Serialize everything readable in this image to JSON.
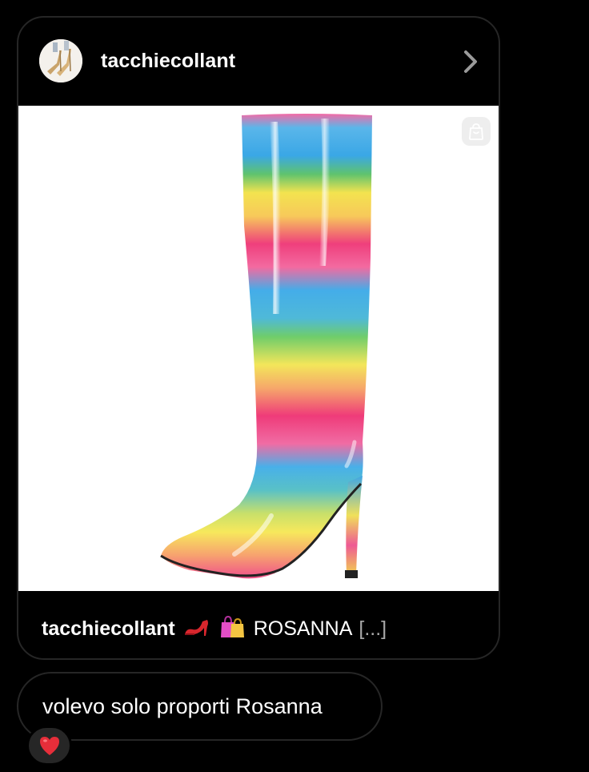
{
  "post": {
    "username": "tacchiecollant",
    "avatar_icon": "gold-heels-avatar",
    "image_icon": "rainbow-stiletto-boot",
    "shopping_icon": "shopping-bag-icon",
    "caption": {
      "username": "tacchiecollant",
      "emojis": [
        "high-heel-icon",
        "shopping-bags-icon"
      ],
      "text": "ROSANNA",
      "more": "[...]"
    }
  },
  "message": {
    "text": "volevo solo proporti Rosanna",
    "reaction": "red-heart-icon"
  },
  "colors": {
    "background": "#000000",
    "bubble_border": "#262626",
    "text": "#ffffff",
    "muted_text": "#a8a8a8",
    "reaction_bg": "#262626"
  }
}
